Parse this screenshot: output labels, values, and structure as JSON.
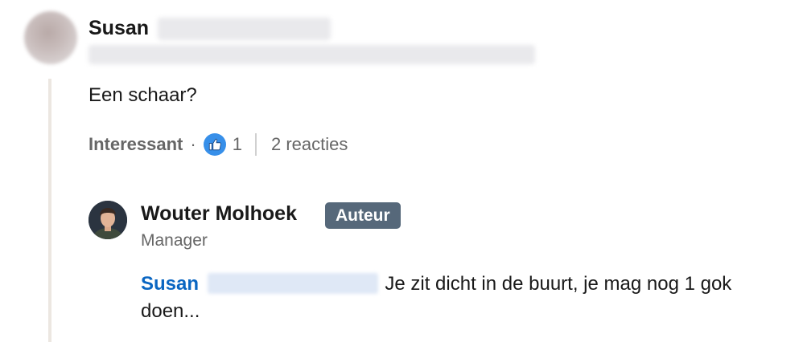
{
  "comment": {
    "author_first_name": "Susan",
    "text": "Een schaar?",
    "reaction_label": "Interessant",
    "separator": "·",
    "like_count": "1",
    "replies_label": "2 reacties",
    "reaction_icon": "thumbs-up-icon"
  },
  "reply": {
    "author_name": "Wouter Molhoek",
    "badge": "Auteur",
    "role": "Manager",
    "mention_first_name": "Susan",
    "text": "Je zit dicht in de buurt, je mag nog 1 gok doen..."
  },
  "colors": {
    "thread_line": "#ece7e1",
    "mention": "#0a66c2",
    "badge_bg": "#56687a",
    "like_icon_bg": "#378fe9"
  }
}
